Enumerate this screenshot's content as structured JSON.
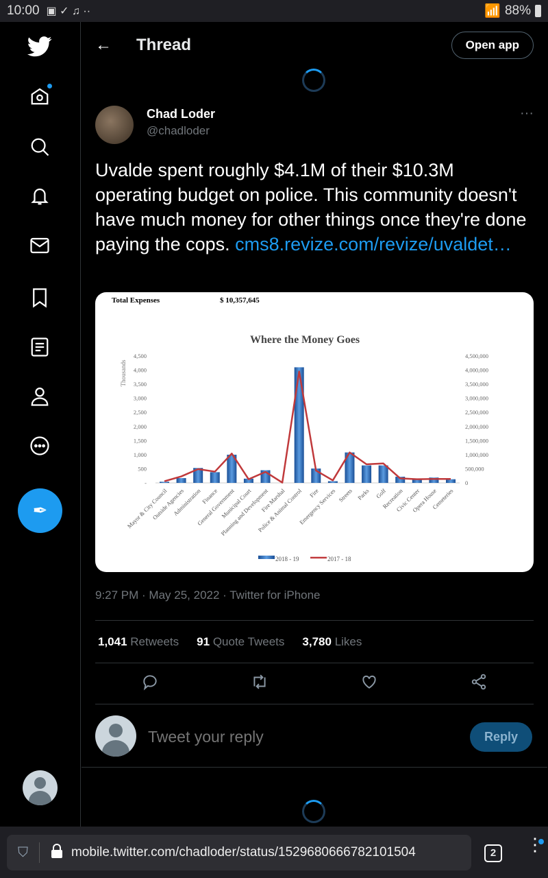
{
  "status": {
    "time": "10:00",
    "battery": "88%"
  },
  "header": {
    "title": "Thread",
    "open_app": "Open app"
  },
  "tweet": {
    "name": "Chad Loder",
    "handle": "@chadloder",
    "text": "Uvalde spent roughly $4.1M of their $10.3M operating budget on police. This community doesn't have much money for other things once they're done paying the cops. ",
    "link": "cms8.revize.com/revize/uvaldet…",
    "meta": "9:27 PM · May 25, 2022 · Twitter for iPhone",
    "retweets": "1,041",
    "retweets_label": "Retweets",
    "quotes": "91",
    "quotes_label": "Quote Tweets",
    "likes": "3,780",
    "likes_label": "Likes"
  },
  "reply": {
    "placeholder": "Tweet your reply",
    "button": "Reply"
  },
  "browser": {
    "url": "mobile.twitter.com/chadloder/status/1529680666782101504",
    "tabs": "2"
  },
  "colors": {
    "accent": "#1d9bf0",
    "bar": "#2e6fbf",
    "line": "#c0393b"
  },
  "chart_data": {
    "type": "bar",
    "header_label": "Total Expenses",
    "header_value": "$   10,357,645",
    "title": "Where the Money Goes",
    "ylabel": "Thousands",
    "ylim": [
      0,
      4500
    ],
    "y_ticks": [
      "-",
      "500",
      "1,000",
      "1,500",
      "2,000",
      "2,500",
      "3,000",
      "3,500",
      "4,000",
      "4,500"
    ],
    "y2lim": [
      0,
      4500000
    ],
    "y2_ticks": [
      "0",
      "500,000",
      "1,000,000",
      "1,500,000",
      "2,000,000",
      "2,500,000",
      "3,000,000",
      "3,500,000",
      "4,000,000",
      "4,500,000"
    ],
    "categories": [
      "Mayor & City Council",
      "Outside Agencies",
      "Administration",
      "Finance",
      "General Government",
      "Municipal Court",
      "Planning and Development",
      "Fire Marshal",
      "Police & Animal Control",
      "Fire",
      "Emergency Services",
      "Streets",
      "Parks",
      "Golf",
      "Recreation",
      "Civic Center",
      "Opera House",
      "Cemeteries"
    ],
    "series": [
      {
        "name": "2018 - 19",
        "type": "bar",
        "axis": "left",
        "values": [
          40,
          170,
          530,
          380,
          1000,
          150,
          450,
          0,
          4100,
          510,
          60,
          1080,
          620,
          620,
          220,
          130,
          190,
          130
        ]
      },
      {
        "name": "2017 - 18",
        "type": "line",
        "axis": "right",
        "values": [
          60000,
          230000,
          490000,
          400000,
          1040000,
          130000,
          390000,
          10000,
          3950000,
          440000,
          90000,
          1080000,
          660000,
          690000,
          160000,
          130000,
          140000,
          140000
        ]
      }
    ],
    "legend": "bottom",
    "grid": false
  }
}
